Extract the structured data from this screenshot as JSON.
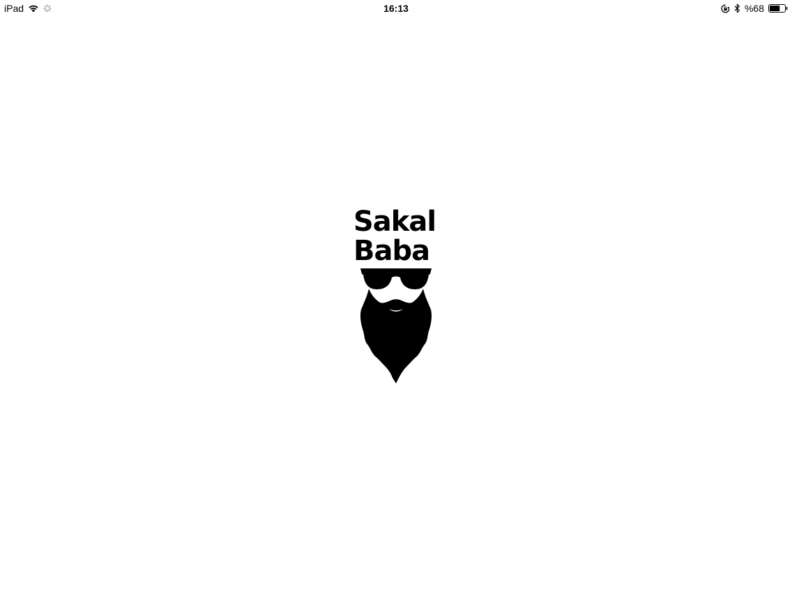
{
  "status_bar": {
    "device": "iPad",
    "time": "16:13",
    "battery_percent": "%68",
    "battery_level": 0.68,
    "icons": [
      "wifi-icon",
      "activity-spinner-icon",
      "rotation-lock-icon",
      "bluetooth-icon",
      "battery-icon"
    ]
  },
  "splash": {
    "logo_line1": "Sakal",
    "logo_line2": "Baba",
    "logo_icon": "bearded-man-sunglasses-icon",
    "background_color": "#ffffff",
    "logo_color": "#000000"
  }
}
